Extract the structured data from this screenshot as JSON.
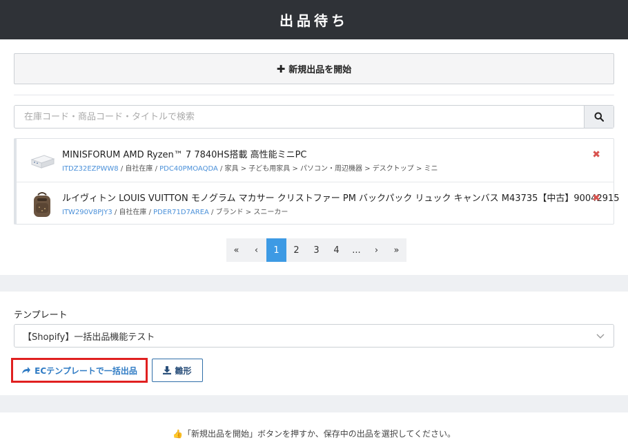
{
  "header": {
    "title": "出品待ち"
  },
  "toolbar": {
    "new_listing_label": "新規出品を開始"
  },
  "search": {
    "placeholder": "在庫コード・商品コード・タイトルで検索"
  },
  "items": [
    {
      "title": "MINISFORUM AMD Ryzen™ 7 7840HS搭載 高性能ミニPC",
      "stock_code": "ITDZ32EZPWW8",
      "stock_sep": " / 自社在庫 / ",
      "product_code": "PDC40PMOAQDA",
      "category": " / 家具 > 子ども用家具 > パソコン・周辺機器 > デスクトップ > ミニ"
    },
    {
      "title": "ルイヴィトン LOUIS VUITTON モノグラム マカサー クリストファー PM バックパック リュック キャンバス M43735【中古】90042915",
      "stock_code": "ITW290V8PJY3",
      "stock_sep": " / 自社在庫 / ",
      "product_code": "PDER71D7AREA",
      "category": " / ブランド > スニーカー"
    }
  ],
  "pagination": {
    "first": "«",
    "prev": "‹",
    "pages": [
      "1",
      "2",
      "3",
      "4"
    ],
    "ellipsis": "...",
    "next": "›",
    "last": "»",
    "current_page": 1
  },
  "template": {
    "label": "テンプレート",
    "selected": "【Shopify】一括出品機能テスト"
  },
  "actions": {
    "ec_bulk_label": "ECテンプレートで一括出品",
    "download_label": "雛形"
  },
  "notice": {
    "text": "「新規出品を開始」ボタンを押すか、保存中の出品を選択してください。"
  },
  "colors": {
    "header_bg": "#2f3237",
    "accent": "#3d9ae4",
    "delete": "#d9534f",
    "highlight_border": "#e02020"
  }
}
